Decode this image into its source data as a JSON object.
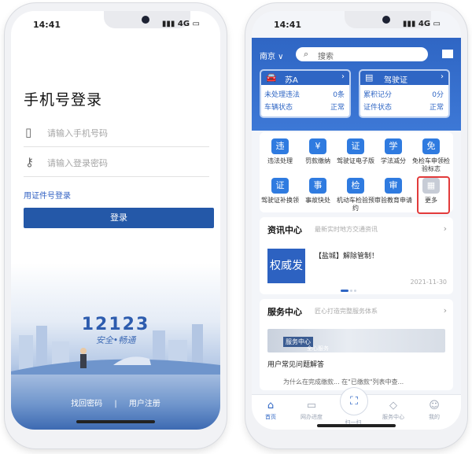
{
  "left_phone": {
    "status": {
      "time": "14:41",
      "signal": "4G"
    },
    "title": "手机号登录",
    "phone_placeholder": "请输入手机号码",
    "password_placeholder": "请输入登录密码",
    "alt_login": "用证件号登录",
    "login_button": "登录",
    "brand": "12123",
    "slogan": "安全•畅通",
    "forgot": "找回密码",
    "separator": "|",
    "register": "用户注册"
  },
  "right_phone": {
    "status": {
      "time": "14:41",
      "signal": "4G"
    },
    "city": "南京 ∨",
    "search_text": "搜索",
    "vehicle_card": {
      "title": "苏A",
      "row1_label": "未处理违法",
      "row1_value": "0条",
      "row2_label": "车辆状态",
      "row2_value": "正常"
    },
    "license_card": {
      "title": "驾驶证",
      "row1_label": "累积记分",
      "row1_value": "0分",
      "row2_label": "证件状态",
      "row2_value": "正常"
    },
    "services": [
      {
        "label": "违法处理",
        "icon": "违"
      },
      {
        "label": "罚款缴纳",
        "icon": "¥"
      },
      {
        "label": "驾驶证电子版",
        "icon": "证"
      },
      {
        "label": "学法减分",
        "icon": "学"
      },
      {
        "label": "免检车申领检验标志",
        "icon": "免"
      },
      {
        "label": "驾驶证补换领",
        "icon": "证"
      },
      {
        "label": "事故快处",
        "icon": "事"
      },
      {
        "label": "机动车检验预约",
        "icon": "检"
      },
      {
        "label": "审验教育申请",
        "icon": "审"
      },
      {
        "label": "更多",
        "icon": "▦"
      }
    ],
    "news": {
      "title": "资讯中心",
      "subtitle": "最新实时地方交通资讯",
      "image_text": "权威发布",
      "headline": "【盐城】解除管制！",
      "date": "2021-11-30"
    },
    "service_center": {
      "title": "服务中心",
      "subtitle": "匠心打造完整服务体系",
      "tag": "服务中心",
      "tag2": "全心服务",
      "faq": "用户常见问题解答",
      "faq2": "为什么在完成缴款... 在\"已缴款\"列表中查..."
    },
    "tabs": [
      {
        "label": "首页",
        "icon": "⌂"
      },
      {
        "label": "网办进度",
        "icon": "▭"
      },
      {
        "label": "扫一扫",
        "icon": "⛶"
      },
      {
        "label": "服务中心",
        "icon": "◇"
      },
      {
        "label": "我的",
        "icon": "☺"
      }
    ]
  }
}
